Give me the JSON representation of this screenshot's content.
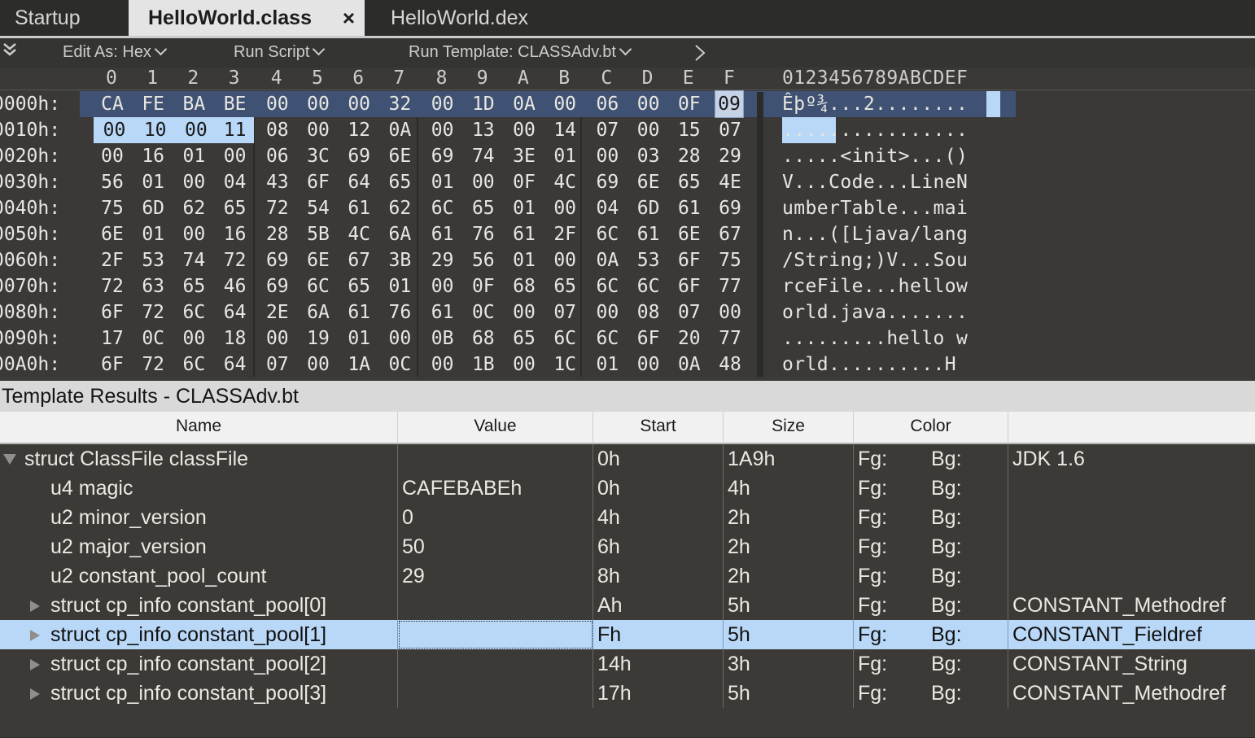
{
  "tabs": [
    {
      "label": "Startup",
      "active": false
    },
    {
      "label": "HelloWorld.class",
      "active": true,
      "close": "×"
    },
    {
      "label": "HelloWorld.dex",
      "active": false
    }
  ],
  "toolbar": {
    "edit_as": "Edit As: Hex",
    "run_script": "Run Script",
    "run_template": "Run Template: CLASSAdv.bt"
  },
  "hex": {
    "column_labels": [
      "0",
      "1",
      "2",
      "3",
      "4",
      "5",
      "6",
      "7",
      "8",
      "9",
      "A",
      "B",
      "C",
      "D",
      "E",
      "F"
    ],
    "ascii_header": "0123456789ABCDEF",
    "rows": [
      {
        "addr": "0000h:",
        "bytes": [
          "CA",
          "FE",
          "BA",
          "BE",
          "00",
          "00",
          "00",
          "32",
          "00",
          "1D",
          "0A",
          "00",
          "06",
          "00",
          "0F",
          "09"
        ],
        "ascii": "Êþº¾...2........"
      },
      {
        "addr": "0010h:",
        "bytes": [
          "00",
          "10",
          "00",
          "11",
          "08",
          "00",
          "12",
          "0A",
          "00",
          "13",
          "00",
          "14",
          "07",
          "00",
          "15",
          "07"
        ],
        "ascii": "................"
      },
      {
        "addr": "0020h:",
        "bytes": [
          "00",
          "16",
          "01",
          "00",
          "06",
          "3C",
          "69",
          "6E",
          "69",
          "74",
          "3E",
          "01",
          "00",
          "03",
          "28",
          "29"
        ],
        "ascii": ".....<init>...()"
      },
      {
        "addr": "0030h:",
        "bytes": [
          "56",
          "01",
          "00",
          "04",
          "43",
          "6F",
          "64",
          "65",
          "01",
          "00",
          "0F",
          "4C",
          "69",
          "6E",
          "65",
          "4E"
        ],
        "ascii": "V...Code...LineN"
      },
      {
        "addr": "0040h:",
        "bytes": [
          "75",
          "6D",
          "62",
          "65",
          "72",
          "54",
          "61",
          "62",
          "6C",
          "65",
          "01",
          "00",
          "04",
          "6D",
          "61",
          "69"
        ],
        "ascii": "umberTable...mai"
      },
      {
        "addr": "0050h:",
        "bytes": [
          "6E",
          "01",
          "00",
          "16",
          "28",
          "5B",
          "4C",
          "6A",
          "61",
          "76",
          "61",
          "2F",
          "6C",
          "61",
          "6E",
          "67"
        ],
        "ascii": "n...([Ljava/lang"
      },
      {
        "addr": "0060h:",
        "bytes": [
          "2F",
          "53",
          "74",
          "72",
          "69",
          "6E",
          "67",
          "3B",
          "29",
          "56",
          "01",
          "00",
          "0A",
          "53",
          "6F",
          "75"
        ],
        "ascii": "/String;)V...Sou"
      },
      {
        "addr": "0070h:",
        "bytes": [
          "72",
          "63",
          "65",
          "46",
          "69",
          "6C",
          "65",
          "01",
          "00",
          "0F",
          "68",
          "65",
          "6C",
          "6C",
          "6F",
          "77"
        ],
        "ascii": "rceFile...hellow"
      },
      {
        "addr": "0080h:",
        "bytes": [
          "6F",
          "72",
          "6C",
          "64",
          "2E",
          "6A",
          "61",
          "76",
          "61",
          "0C",
          "00",
          "07",
          "00",
          "08",
          "07",
          "00"
        ],
        "ascii": "orld.java......."
      },
      {
        "addr": "0090h:",
        "bytes": [
          "17",
          "0C",
          "00",
          "18",
          "00",
          "19",
          "01",
          "00",
          "0B",
          "68",
          "65",
          "6C",
          "6C",
          "6F",
          "20",
          "77"
        ],
        "ascii": ".........hello w"
      },
      {
        "addr": "00A0h:",
        "bytes": [
          "6F",
          "72",
          "6C",
          "64",
          "07",
          "00",
          "1A",
          "0C",
          "00",
          "1B",
          "00",
          "1C",
          "01",
          "00",
          "0A",
          "48"
        ],
        "ascii": "orld..........H"
      }
    ]
  },
  "template_results": {
    "title": "Template Results - CLASSAdv.bt",
    "columns": [
      "Name",
      "Value",
      "Start",
      "Size",
      "Color"
    ],
    "rows": [
      {
        "name": "struct ClassFile classFile",
        "value": "",
        "start": "0h",
        "size": "1A9h",
        "fg": "Fg:",
        "bg": "Bg:",
        "comment": "JDK 1.6"
      },
      {
        "name": "u4 magic",
        "value": "CAFEBABEh",
        "start": "0h",
        "size": "4h",
        "fg": "Fg:",
        "bg": "Bg:",
        "comment": ""
      },
      {
        "name": "u2 minor_version",
        "value": "0",
        "start": "4h",
        "size": "2h",
        "fg": "Fg:",
        "bg": "Bg:",
        "comment": ""
      },
      {
        "name": "u2 major_version",
        "value": "50",
        "start": "6h",
        "size": "2h",
        "fg": "Fg:",
        "bg": "Bg:",
        "comment": ""
      },
      {
        "name": "u2 constant_pool_count",
        "value": "29",
        "start": "8h",
        "size": "2h",
        "fg": "Fg:",
        "bg": "Bg:",
        "comment": ""
      },
      {
        "name": "struct cp_info constant_pool[0]",
        "value": "",
        "start": "Ah",
        "size": "5h",
        "fg": "Fg:",
        "bg": "Bg:",
        "comment": "CONSTANT_Methodref"
      },
      {
        "name": "struct cp_info constant_pool[1]",
        "value": "",
        "start": "Fh",
        "size": "5h",
        "fg": "Fg:",
        "bg": "Bg:",
        "comment": "CONSTANT_Fieldref"
      },
      {
        "name": "struct cp_info constant_pool[2]",
        "value": "",
        "start": "14h",
        "size": "3h",
        "fg": "Fg:",
        "bg": "Bg:",
        "comment": "CONSTANT_String"
      },
      {
        "name": "struct cp_info constant_pool[3]",
        "value": "",
        "start": "17h",
        "size": "5h",
        "fg": "Fg:",
        "bg": "Bg:",
        "comment": "CONSTANT_Methodref"
      }
    ]
  }
}
